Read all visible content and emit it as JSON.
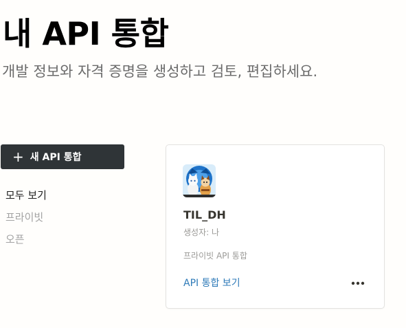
{
  "header": {
    "title": "내 API 통합",
    "subtitle": "개발 정보와 자격 증명을 생성하고 검토, 편집하세요."
  },
  "new_button": {
    "icon": "plus-icon",
    "label": "새 API 통합"
  },
  "filters": [
    {
      "label": "모두 보기",
      "active": true
    },
    {
      "label": "프라이빗",
      "active": false
    },
    {
      "label": "오픈",
      "active": false
    }
  ],
  "integrations": [
    {
      "name": "TIL_DH",
      "creator": "생성자: 나",
      "type": "프라이빗 API 통합",
      "link_label": "API 통합 보기",
      "avatar_icon": "cats-avatar-icon",
      "more_icon": "more-options-icon"
    }
  ],
  "colors": {
    "button_bg": "#2f3437",
    "link": "#2e7ab8",
    "page_bg": "#fffefc",
    "muted_text": "#9b9a97"
  }
}
